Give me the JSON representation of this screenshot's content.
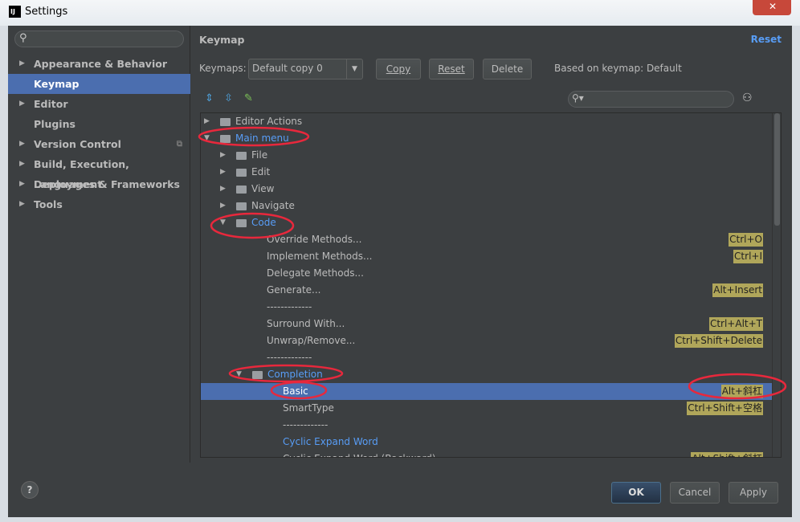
{
  "window": {
    "title": "Settings",
    "logo": "IJ",
    "close_icon": "close-icon"
  },
  "sidebar": {
    "search_placeholder": "",
    "items": [
      {
        "label": "Appearance & Behavior",
        "arrow": true
      },
      {
        "label": "Keymap",
        "arrow": false,
        "selected": true
      },
      {
        "label": "Editor",
        "arrow": true
      },
      {
        "label": "Plugins",
        "arrow": false
      },
      {
        "label": "Version Control",
        "arrow": true,
        "extra": "⧉"
      },
      {
        "label": "Build, Execution, Deployment",
        "arrow": true
      },
      {
        "label": "Languages & Frameworks",
        "arrow": true
      },
      {
        "label": "Tools",
        "arrow": true
      }
    ]
  },
  "main": {
    "title": "Keymap",
    "reset_link": "Reset",
    "keymaps_label": "Keymaps:",
    "keymap_value": "Default copy 0",
    "buttons": {
      "copy": "Copy",
      "reset": "Reset",
      "delete": "Delete"
    },
    "based_on": "Based on keymap: Default",
    "filter_value": ""
  },
  "tree": [
    {
      "label": "Editor Actions",
      "level": 0,
      "arrow": "right",
      "icon": "folder-actions"
    },
    {
      "label": "Main menu",
      "level": 0,
      "arrow": "down",
      "icon": "folder-menu",
      "blue": true
    },
    {
      "label": "File",
      "level": 1,
      "arrow": "right",
      "icon": "folder"
    },
    {
      "label": "Edit",
      "level": 1,
      "arrow": "right",
      "icon": "folder"
    },
    {
      "label": "View",
      "level": 1,
      "arrow": "right",
      "icon": "folder"
    },
    {
      "label": "Navigate",
      "level": 1,
      "arrow": "right",
      "icon": "folder"
    },
    {
      "label": "Code",
      "level": 1,
      "arrow": "down",
      "icon": "folder",
      "blue": true
    },
    {
      "label": "Override Methods...",
      "level": 2,
      "shortcut": "Ctrl+O"
    },
    {
      "label": "Implement Methods...",
      "level": 2,
      "shortcut": "Ctrl+I"
    },
    {
      "label": "Delegate Methods...",
      "level": 2
    },
    {
      "label": "Generate...",
      "level": 2,
      "shortcut": "Alt+Insert"
    },
    {
      "label": "-------------",
      "level": 2
    },
    {
      "label": "Surround With...",
      "level": 2,
      "shortcut": "Ctrl+Alt+T"
    },
    {
      "label": "Unwrap/Remove...",
      "level": 2,
      "shortcut": "Ctrl+Shift+Delete"
    },
    {
      "label": "-------------",
      "level": 2
    },
    {
      "label": "Completion",
      "level": 2,
      "arrow": "down",
      "icon": "folder",
      "blue": true,
      "folderlevel": true
    },
    {
      "label": "Basic",
      "level": 3,
      "shortcut": "Alt+斜杠",
      "selected": true
    },
    {
      "label": "SmartType",
      "level": 3,
      "shortcut": "Ctrl+Shift+空格"
    },
    {
      "label": "-------------",
      "level": 3
    },
    {
      "label": "Cyclic Expand Word",
      "level": 3,
      "blue": true
    },
    {
      "label": "Cyclic Expand Word (Backward)",
      "level": 3,
      "shortcut": "Alt+Shift+斜杠"
    }
  ],
  "footer": {
    "help": "?",
    "ok": "OK",
    "cancel": "Cancel",
    "apply": "Apply"
  },
  "colors": {
    "selection": "#4b6eaf",
    "link": "#589df6",
    "shortcut_bg": "#b0a65a",
    "annotation": "#e8283c"
  }
}
